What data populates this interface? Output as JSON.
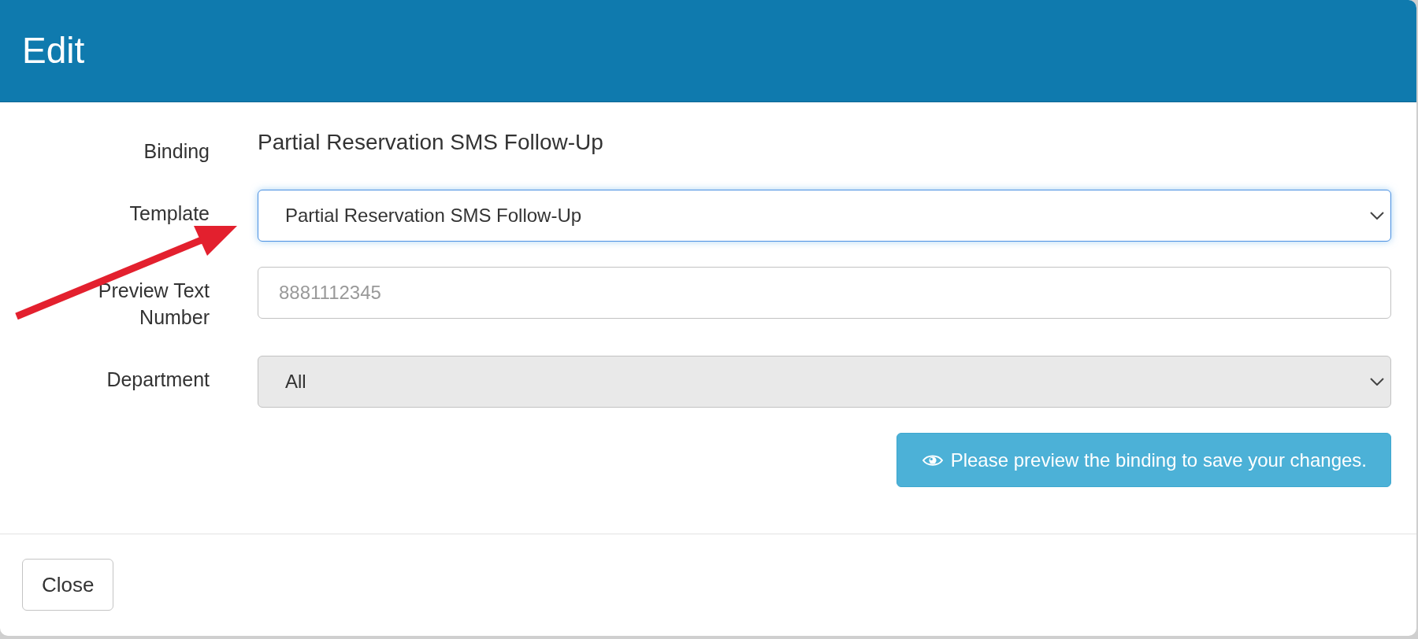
{
  "dialog": {
    "title": "Edit"
  },
  "form": {
    "fields": [
      {
        "kind": "static",
        "label": "Binding",
        "value": "Partial Reservation SMS Follow-Up"
      },
      {
        "kind": "select",
        "label": "Template",
        "value": "Partial Reservation SMS Follow-Up",
        "focused": true,
        "disabled": false
      },
      {
        "kind": "input",
        "label": "Preview Text Number",
        "placeholder": "8881112345",
        "focused": false,
        "disabled": false
      },
      {
        "kind": "select",
        "label": "Department",
        "value": "All",
        "focused": false,
        "disabled": true
      }
    ]
  },
  "preview_button": {
    "label": "Please preview the binding to save your changes."
  },
  "footer": {
    "buttons": [
      {
        "label": "Close"
      }
    ]
  }
}
